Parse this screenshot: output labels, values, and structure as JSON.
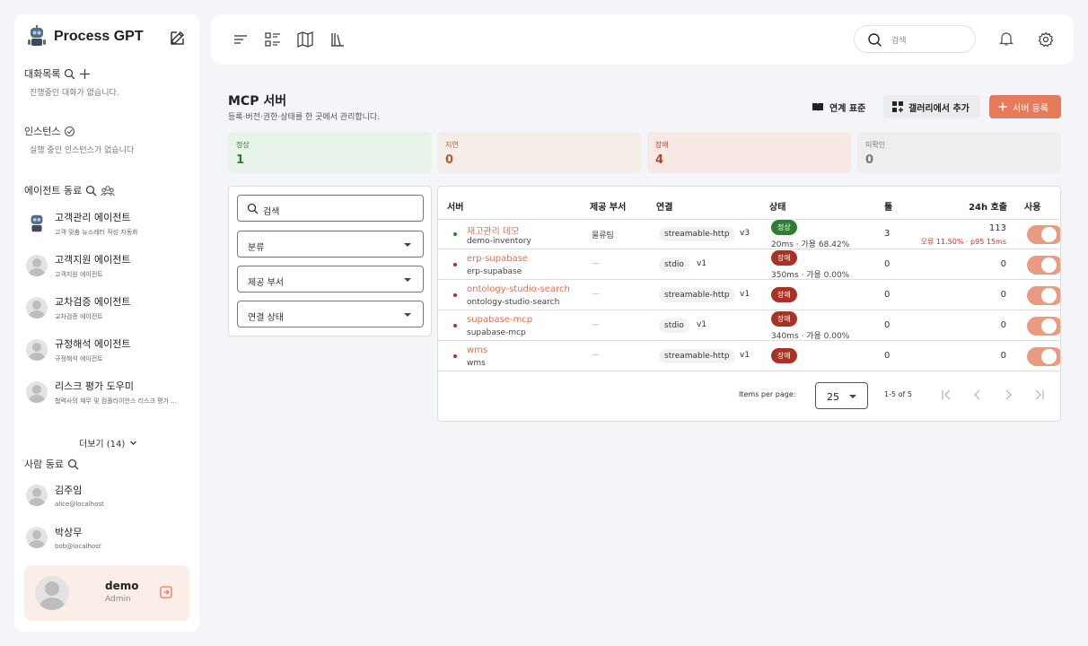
{
  "sidebar": {
    "brand": "Process GPT",
    "conversations": {
      "title": "대화목록",
      "empty": "진행중인 대화가 없습니다."
    },
    "instances": {
      "title": "인스턴스",
      "empty": "실행 중인 인스턴스가 없습니다"
    },
    "agents": {
      "title": "에이전트 동료",
      "items": [
        {
          "name": "고객관리 에이전트",
          "desc": "고객 맞춤 뉴스레터 작성 자동화"
        },
        {
          "name": "고객지원 에이전트",
          "desc": "고객지원 에이전트"
        },
        {
          "name": "교차검증 에이전트",
          "desc": "교차검증 에이전트"
        },
        {
          "name": "규정해석 에이전트",
          "desc": "규정해석 에이전트"
        },
        {
          "name": "리스크 평가 도우미",
          "desc": "협력사의 재무 및 컴플라이언스 리스크 평가 ..."
        }
      ],
      "more": "더보기 (14)"
    },
    "people": {
      "title": "사람 동료",
      "items": [
        {
          "name": "김주임",
          "email": "alice@localhost"
        },
        {
          "name": "박상무",
          "email": "bob@localhost"
        }
      ]
    },
    "user": {
      "name": "demo",
      "role": "Admin"
    }
  },
  "topbar": {
    "search_placeholder": "검색"
  },
  "main": {
    "title": "MCP 서버",
    "subtitle": "등록·버전·권한·상태를 한 곳에서 관리합니다.",
    "buttons": {
      "link": "연계 표준",
      "gallery": "갤러리에서 추가",
      "add": "서버 등록"
    },
    "stats": [
      {
        "label": "정상",
        "value": "1",
        "bg": "#e8f3ea",
        "fg": "#2e7d32"
      },
      {
        "label": "지연",
        "value": "0",
        "bg": "#f5ede7",
        "fg": "#b65b3a"
      },
      {
        "label": "장애",
        "value": "4",
        "bg": "#f7e8e3",
        "fg": "#b5422b"
      },
      {
        "label": "미확인",
        "value": "0",
        "bg": "#eeeeee",
        "fg": "#777777"
      }
    ],
    "filters": {
      "search": "검색",
      "category": "분류",
      "dept": "제공 부서",
      "conn_state": "연결 상태"
    },
    "table": {
      "headers": {
        "server": "서버",
        "dept": "제공 부서",
        "conn": "연결",
        "status": "상태",
        "tools": "툴",
        "calls": "24h 호출",
        "use": "사용"
      },
      "rows": [
        {
          "name": "재고관리 데모",
          "id": "demo-inventory",
          "dept": "물류팀",
          "transport": "streamable-http",
          "version": "v3",
          "status": "정상",
          "status_color": "#2e7d32",
          "latency": "20ms · 가용 68.42%",
          "tools": "3",
          "calls": "113",
          "error": "오류 11.50% · p95 15ms",
          "dot": "#2e7d32"
        },
        {
          "name": "erp-supabase",
          "id": "erp-supabase",
          "dept": "—",
          "transport": "stdio",
          "version": "v1",
          "status": "장애",
          "status_color": "#a93226",
          "latency": "350ms · 가용 0.00%",
          "tools": "0",
          "calls": "0",
          "error": "",
          "dot": "#a93226"
        },
        {
          "name": "ontology-studio-search",
          "id": "ontology-studio-search",
          "dept": "—",
          "transport": "streamable-http",
          "version": "v1",
          "status": "장애",
          "status_color": "#a93226",
          "latency": "",
          "tools": "0",
          "calls": "0",
          "error": "",
          "dot": "#a93226"
        },
        {
          "name": "supabase-mcp",
          "id": "supabase-mcp",
          "dept": "—",
          "transport": "stdio",
          "version": "v1",
          "status": "장애",
          "status_color": "#a93226",
          "latency": "340ms · 가용 0.00%",
          "tools": "0",
          "calls": "0",
          "error": "",
          "dot": "#a93226"
        },
        {
          "name": "wms",
          "id": "wms",
          "dept": "—",
          "transport": "streamable-http",
          "version": "v1",
          "status": "장애",
          "status_color": "#a93226",
          "latency": "",
          "tools": "0",
          "calls": "0",
          "error": "",
          "dot": "#a93226"
        }
      ]
    },
    "pager": {
      "label": "Items per page:",
      "per_page": "25",
      "range": "1-5 of 5"
    }
  }
}
